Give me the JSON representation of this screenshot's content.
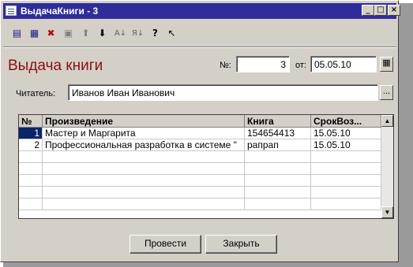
{
  "window": {
    "title": "ВыдачаКниги - 3",
    "controls": {
      "minimize": "_",
      "maximize": "□",
      "close": "×"
    }
  },
  "toolbar": {
    "icons": [
      "new-row-icon",
      "edit-row-icon",
      "delete-row-icon",
      "copy-row-icon",
      "move-up-icon",
      "move-down-icon",
      "sort-asc-icon",
      "sort-desc-icon",
      "help-icon",
      "context-help-icon"
    ]
  },
  "form": {
    "heading": "Выдача книги",
    "number_label": "№:",
    "number_value": "3",
    "date_label": "от:",
    "date_value": "05.05.10",
    "reader_label": "Читатель:",
    "reader_value": "Иванов Иван Иванович",
    "select_button": "..."
  },
  "table": {
    "columns": [
      "№",
      "Произведение",
      "Книга",
      "СрокВоз..."
    ],
    "rows": [
      {
        "n": "1",
        "work": "Мастер и Маргарита",
        "book": "154654413",
        "due": "15.05.10"
      },
      {
        "n": "2",
        "work": "Профессиональная разработка в системе \"",
        "book": "рапрап",
        "due": "15.05.10"
      }
    ],
    "selected_row": 0
  },
  "buttons": {
    "post": "Провести",
    "close": "Закрыть"
  }
}
